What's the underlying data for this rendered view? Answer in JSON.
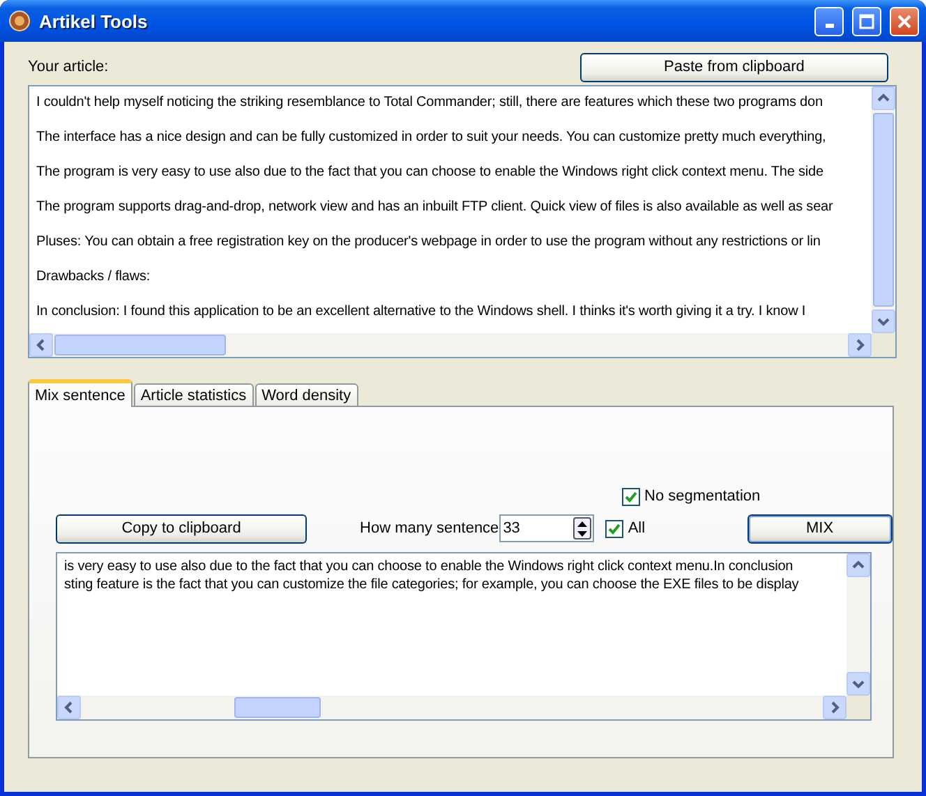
{
  "window": {
    "title": "Artikel Tools"
  },
  "article": {
    "label": "Your article:",
    "paste_button": "Paste from clipboard",
    "lines": [
      "I couldn't help myself noticing the striking resemblance to Total Commander; still, there are features which these two programs don",
      "The interface has a nice design and can be fully customized in order to suit your needs. You can customize pretty much everything,",
      "The program is very easy to use also due to the fact that you can choose to enable the Windows right click context menu. The side",
      "The program supports drag-and-drop, network view and has an inbuilt FTP client. Quick view of files is also available as well as sear",
      "Pluses: You can obtain a free registration key on the producer's webpage in order to use the program without any restrictions or lin",
      "Drawbacks / flaws:",
      "In conclusion: I found this application to be an excellent alternative to the Windows shell. I thinks it's worth giving it a try. I know I"
    ]
  },
  "tabs": [
    {
      "label": "Mix sentence",
      "selected": true
    },
    {
      "label": "Article statistics",
      "selected": false
    },
    {
      "label": "Word density",
      "selected": false
    }
  ],
  "mix": {
    "no_segmentation": {
      "label": "No segmentation",
      "checked": true
    },
    "copy_button": "Copy to clipboard",
    "count_label": "How many sentence",
    "count_value": "33",
    "all": {
      "label": "All",
      "checked": true
    },
    "mix_button": "MIX",
    "output_lines": [
      "is very easy to use also due to the fact that you can choose to enable the Windows right click context menu.In conclusion",
      "sting feature is the fact that you can customize the file categories; for example, you can choose the EXE files to be display"
    ]
  }
}
